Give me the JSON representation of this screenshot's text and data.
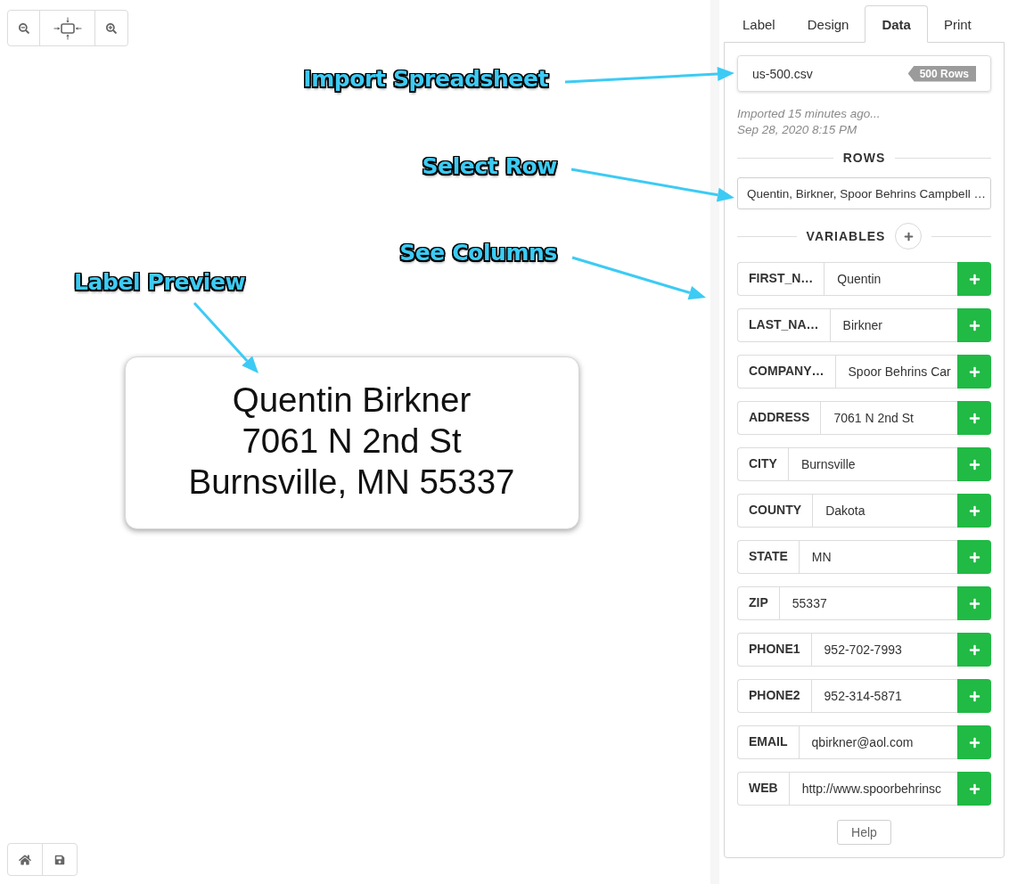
{
  "annotations": [
    {
      "text": "Import Spreadsheet"
    },
    {
      "text": "Select Row"
    },
    {
      "text": "See Columns"
    },
    {
      "text": "Label Preview"
    }
  ],
  "label_preview": {
    "lines": [
      "Quentin Birkner",
      "7061 N 2nd St",
      "Burnsville, MN 55337"
    ]
  },
  "tabs": [
    {
      "label": "Label",
      "selected": false
    },
    {
      "label": "Design",
      "selected": false
    },
    {
      "label": "Data",
      "selected": true
    },
    {
      "label": "Print",
      "selected": false
    }
  ],
  "data_panel": {
    "file": {
      "name": "us-500.csv",
      "badge": "500 Rows"
    },
    "import_info": [
      "Imported 15 minutes ago...",
      "Sep 28, 2020 8:15 PM"
    ],
    "rows_heading": "ROWS",
    "row_select": "Quentin, Birkner, Spoor Behrins Campbell …",
    "variables_heading": "VARIABLES",
    "variables": [
      {
        "name": "FIRST_N…",
        "value": "Quentin"
      },
      {
        "name": "LAST_NA…",
        "value": "Birkner"
      },
      {
        "name": "COMPANY…",
        "value": "Spoor Behrins Car"
      },
      {
        "name": "ADDRESS",
        "value": "7061 N 2nd St"
      },
      {
        "name": "CITY",
        "value": "Burnsville"
      },
      {
        "name": "COUNTY",
        "value": "Dakota"
      },
      {
        "name": "STATE",
        "value": "MN"
      },
      {
        "name": "ZIP",
        "value": "55337"
      },
      {
        "name": "PHONE1",
        "value": "952-702-7993"
      },
      {
        "name": "PHONE2",
        "value": "952-314-5871"
      },
      {
        "name": "EMAIL",
        "value": "qbirkner@aol.com"
      },
      {
        "name": "WEB",
        "value": "http://www.spoorbehrinsc"
      }
    ],
    "help_button": "Help"
  }
}
